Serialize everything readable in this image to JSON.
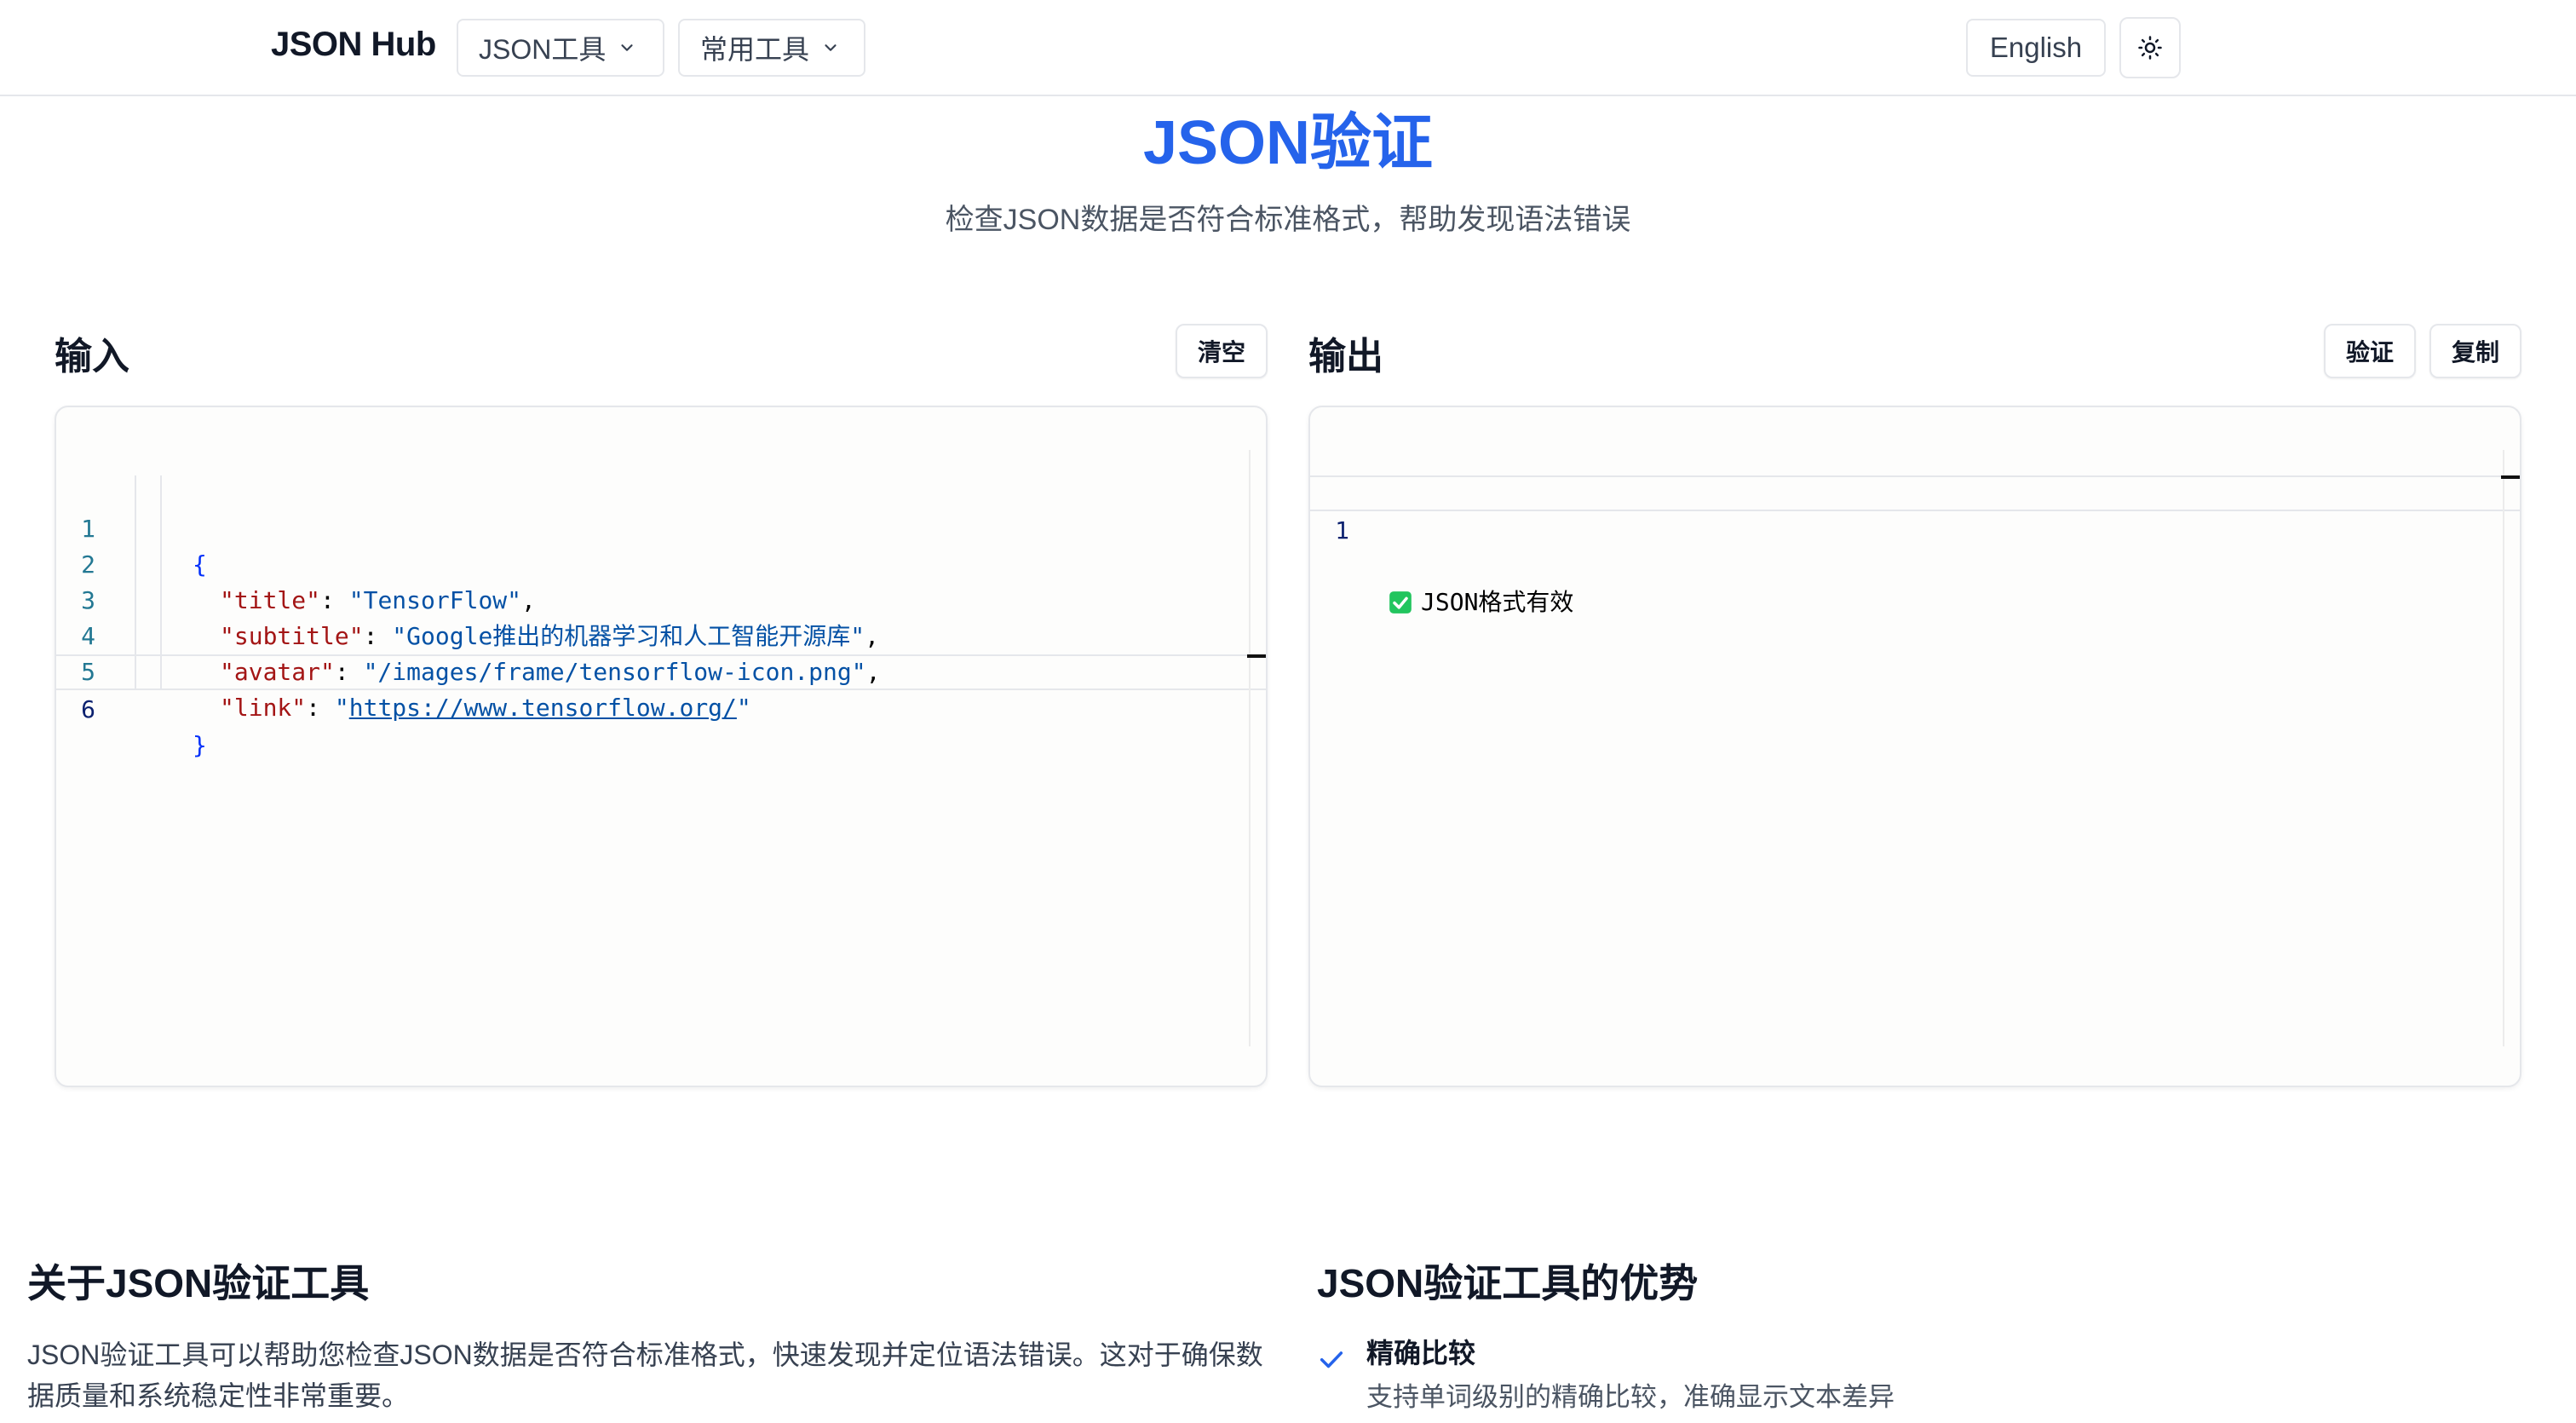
{
  "header": {
    "brand": "JSON Hub",
    "nav": [
      {
        "label": "JSON工具",
        "icon": "chevron-down-icon"
      },
      {
        "label": "常用工具",
        "icon": "chevron-down-icon"
      }
    ],
    "language": "English",
    "theme_icon": "sun-icon"
  },
  "hero": {
    "title": "JSON验证",
    "subtitle": "检查JSON数据是否符合标准格式，帮助发现语法错误"
  },
  "input_panel": {
    "title": "输入",
    "clear_label": "清空",
    "lines": [
      {
        "n": "1",
        "text": "{"
      },
      {
        "n": "2",
        "key": "\"title\"",
        "value": "\"TensorFlow\"",
        "trail": ","
      },
      {
        "n": "3",
        "key": "\"subtitle\"",
        "value": "\"Google推出的机器学习和人工智能开源库\"",
        "trail": ","
      },
      {
        "n": "4",
        "key": "\"avatar\"",
        "value": "\"/images/frame/tensorflow-icon.png\"",
        "trail": ","
      },
      {
        "n": "5",
        "key": "\"link\"",
        "value_link": "https://www.tensorflow.org/",
        "trail": ""
      },
      {
        "n": "6",
        "text": "}"
      }
    ]
  },
  "output_panel": {
    "title": "输出",
    "validate_label": "验证",
    "copy_label": "复制",
    "lines": [
      {
        "n": "1",
        "text": "JSON格式有效",
        "icon": "check-mark-icon"
      }
    ]
  },
  "about": {
    "title": "关于JSON验证工具",
    "text": "JSON验证工具可以帮助您检查JSON数据是否符合标准格式，快速发现并定位语法错误。这对于确保数据质量和系统稳定性非常重要。"
  },
  "advantages": {
    "title": "JSON验证工具的优势",
    "items": [
      {
        "title": "精确比较",
        "desc": "支持单词级别的精确比较，准确显示文本差异",
        "icon": "check-icon"
      }
    ]
  },
  "colors": {
    "accent": "#2563eb",
    "json_key": "#a31515",
    "json_string": "#0451a5",
    "json_brace": "#0431fa",
    "success": "#22c55e"
  }
}
